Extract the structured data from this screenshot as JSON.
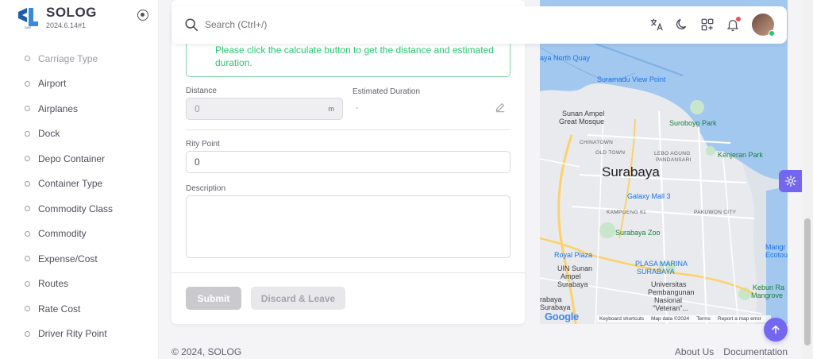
{
  "brand": {
    "name": "SOLOG",
    "version": "2024.6.14#1",
    "logo_mark": "SL",
    "logo_sub": "SAS"
  },
  "sidebar": {
    "items": [
      {
        "label": "Carriage Type"
      },
      {
        "label": "Airport"
      },
      {
        "label": "Airplanes"
      },
      {
        "label": "Dock"
      },
      {
        "label": "Depo Container"
      },
      {
        "label": "Container Type"
      },
      {
        "label": "Commodity Class"
      },
      {
        "label": "Commodity"
      },
      {
        "label": "Expense/Cost"
      },
      {
        "label": "Routes"
      },
      {
        "label": "Rate Cost"
      },
      {
        "label": "Driver Rity Point"
      }
    ]
  },
  "topbar": {
    "search_placeholder": "Search (Ctrl+/)",
    "icons": [
      "translate-icon",
      "moon-icon",
      "grid-add-icon",
      "bell-icon"
    ]
  },
  "form": {
    "alert_text": "Please click the calculate button to get the distance and estimated duration.",
    "distance_label": "Distance",
    "distance_value": "0",
    "distance_unit": "m",
    "duration_label": "Estimated Duration",
    "duration_value": "-",
    "rity_label": "Rity Point",
    "rity_value": "0",
    "description_label": "Description",
    "description_value": "",
    "submit_label": "Submit",
    "discard_label": "Discard & Leave"
  },
  "map": {
    "city": "Surabaya",
    "places": {
      "north_quay": "aya North Quay",
      "suramadu": "Suramadu View Point",
      "sunan_ampel_1": "Sunan Ampel",
      "sunan_ampel_2": "Great Mosque",
      "suroboyo": "Suroboyo Park",
      "chinatown": "CHINATOWN",
      "old_town": "OLD TOWN",
      "lebo_1": "LEBO AGUNG",
      "lebo_2": "PANDANSARI",
      "kenjeran": "Kenjeran Park",
      "galaxy": "Galaxy Mall 3",
      "kampoeng": "KAMPOENG 61",
      "pakuwon": "PAKUWON CITY",
      "zoo": "Surabaya Zoo",
      "royal": "Royal Plaza",
      "marina_1": "PLASA MARINA",
      "marina_2": "SURABAYA",
      "uin_1": "UIN Sunan",
      "uin_2": "Ampel",
      "uin_3": "Surabaya",
      "upn_1": "Universitas",
      "upn_2": "Pembangunan",
      "upn_3": "Nasional",
      "upn_4": "\"Veteran\"...",
      "kebun_1": "Kebun Ra",
      "kebun_2": "Mangrove",
      "mangr_1": "Mangr",
      "mangr_2": "Ecotou",
      "ubaya_1": "rabaya",
      "ubaya_2": "Surabaya"
    },
    "attribution": {
      "google": "Google",
      "shortcuts": "Keyboard shortcuts",
      "data": "Map data ©2024",
      "terms": "Terms",
      "report": "Report a map error"
    },
    "colors": {
      "water": "#a3c8f0",
      "land": "#e8eaed",
      "park": "#c8e6c9",
      "road_major": "#fbd26a",
      "road": "#ffffff"
    }
  },
  "footer": {
    "copyright": "© 2024, SOLOG",
    "links": [
      "About Us",
      "Documentation"
    ]
  },
  "colors": {
    "primary": "#7367f0",
    "success": "#28c76f",
    "danger": "#ea5455"
  }
}
